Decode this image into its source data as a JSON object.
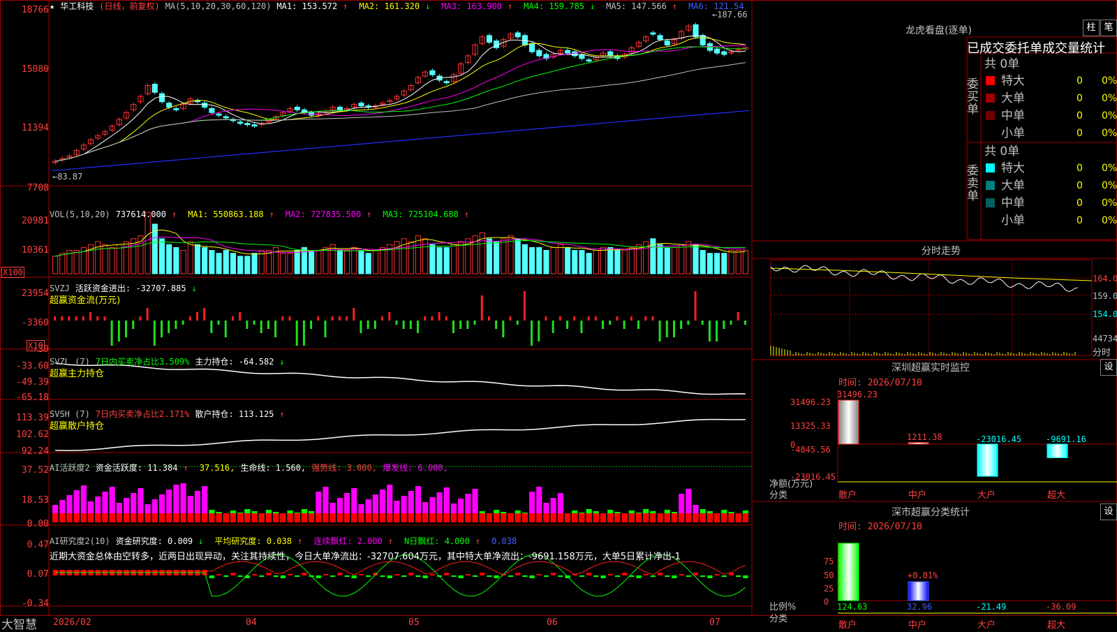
{
  "brand": "大智慧",
  "panels": {
    "price": {
      "star": "★",
      "stock_name": "华工科技",
      "mode": "(日线，前复权)",
      "ma_header": "MA(5,10,20,30,60,120)",
      "items": [
        {
          "label": "MA1: 153.572",
          "arrow": "↑",
          "color": "#ffffff"
        },
        {
          "label": "MA2: 161.320",
          "arrow": "↓",
          "color": "#ffff00"
        },
        {
          "label": "MA3: 163.900",
          "arrow": "↑",
          "color": "#ff00ff"
        },
        {
          "label": "MA4: 159.785",
          "arrow": "↓",
          "color": "#00ff00"
        },
        {
          "label": "MA5: 147.566",
          "arrow": "↑",
          "color": "#c0c0c0"
        },
        {
          "label": "MA6: 121.54",
          "arrow": "",
          "color": "#4060ff"
        }
      ],
      "y_ticks": [
        "18766",
        "15080",
        "11394",
        "7708"
      ],
      "high_mark": "187.66",
      "low_mark": "83.87"
    },
    "vol": {
      "header": "VOL(5,10,20)",
      "value": "737614.000",
      "items": [
        {
          "label": "MA1: 550863.188",
          "arrow": "↑",
          "color": "#ffff00"
        },
        {
          "label": "MA2: 727835.500",
          "arrow": "↑",
          "color": "#ff00ff"
        },
        {
          "label": "MA3: 725104.688",
          "arrow": "↑",
          "color": "#00ff00"
        }
      ],
      "y_ticks": [
        "20981",
        "10361"
      ],
      "unit": "X100"
    },
    "svzj": {
      "header": "SVZJ",
      "label": "活跃资金进出: -32707.885",
      "arrow": "↓",
      "sub": "超赢资金流(万元)",
      "y_ticks": [
        "23954",
        "-3360",
        "-30"
      ],
      "unit": "X10"
    },
    "svzl": {
      "header": "SVZL (7)",
      "green": "7日内买卖净占比3.509%",
      "label": "主力持仓: -64.582",
      "arrow": "↓",
      "sub": "超赢主力持仓",
      "y_ticks": [
        "-33.60",
        "-49.39",
        "-65.18"
      ]
    },
    "svsh": {
      "header": "SVSH (7)",
      "red": "7日内买卖净占比2.171%",
      "label": "散户持仓: 113.125",
      "arrow": "↑",
      "sub": "超赢散户持仓",
      "y_ticks": [
        "113.39",
        "102.62",
        "92.24"
      ]
    },
    "ai1": {
      "header": "AI活跃度2",
      "label": "资金活跃度: 11.384",
      "arrow": "↑",
      "v2": "37.516,",
      "v3": "生命线: 1.560,",
      "v4": "强势线: 3.000,",
      "v5": "爆发线: 6.000,",
      "y_ticks": [
        "37.52",
        "18.53",
        "0.00"
      ]
    },
    "ai2": {
      "header": "AI研究度2(10)",
      "label": "资金研究度: 0.009",
      "arrow": "↓",
      "v2": "平均研究度: 0.038",
      "v3": "连续飘红: 2.000",
      "v4": "N日飘红: 4.000",
      "v5": "0.038",
      "comment": "近期大资金总体由空转多，近两日出现异动，关注其持续性，今日大单净流出：-32707.604万元，其中特大单净流出：-9691.158万元，大单5日累计净出-1",
      "y_ticks": [
        "0.47",
        "0.07",
        "-0.34"
      ]
    }
  },
  "x_labels": [
    "2026/02",
    "04",
    "05",
    "06",
    "07"
  ],
  "right": {
    "lhb_title": "龙虎看盘(逐单)",
    "btn_bar": "柱",
    "btn_pen": "笔",
    "ob_header": "已成交委托单成交量统计",
    "buy_label": "委买单",
    "sell_label": "委卖单",
    "total_buy": "共 0单",
    "total_sell": "共 0单",
    "buy_rows": [
      {
        "name": "特大",
        "count": "0",
        "pct": "0%",
        "color": "#ff0000"
      },
      {
        "name": "大单",
        "count": "0",
        "pct": "0%",
        "color": "#a00000"
      },
      {
        "name": "中单",
        "count": "0",
        "pct": "0%",
        "color": "#700000"
      },
      {
        "name": "小单",
        "count": "0",
        "pct": "0%",
        "color": "#000000"
      }
    ],
    "sell_rows": [
      {
        "name": "特大",
        "count": "0",
        "pct": "0%",
        "color": "#00ffff"
      },
      {
        "name": "大单",
        "count": "0",
        "pct": "0%",
        "color": "#008080"
      },
      {
        "name": "中单",
        "count": "0",
        "pct": "0%",
        "color": "#006060"
      },
      {
        "name": "小单",
        "count": "0",
        "pct": "0%",
        "color": "#000000"
      }
    ],
    "intraday_title": "分时走势",
    "intraday_ticks": [
      "164.0",
      "159.0",
      "154.0"
    ],
    "intraday_vol": "44734",
    "intraday_unit": "分时",
    "sz_title": "深圳超赢实时监控",
    "sz_set": "设",
    "sz_time": "时间: 2026/07/10",
    "sz_yticks": [
      "31496.23",
      "13325.33",
      "0",
      "-4845.56",
      "-23016.45"
    ],
    "sz_label1": "净额(万元)",
    "sz_label2": "分类",
    "sz_cats": [
      "散户",
      "中户",
      "大户",
      "超大"
    ],
    "sz_vals": [
      "31496.23",
      "1211.38",
      "-23016.45",
      "-9691.16"
    ],
    "stat_title": "深市超赢分类统计",
    "stat_set": "设",
    "stat_time": "时间: 2026/07/10",
    "stat_yticks": [
      "75",
      "50",
      "25",
      "0"
    ],
    "stat_label1": "比例%",
    "stat_label2": "分类",
    "stat_cats": [
      "散户",
      "中户",
      "大户",
      "超大"
    ],
    "stat_vals": [
      "124.63",
      "32.96",
      "-21.49",
      "-36.09"
    ],
    "stat_note": "+0.01%"
  },
  "chart_data": [
    {
      "type": "candlestick",
      "title": "华工科技",
      "ylim": [
        7708,
        18766
      ],
      "ma_last": {
        "MA1": 153.572,
        "MA2": 161.32,
        "MA3": 163.9,
        "MA4": 159.785,
        "MA5": 147.566,
        "MA6": 121.54
      },
      "close": [
        84,
        86,
        88,
        92,
        96,
        100,
        103,
        106,
        110,
        115,
        120,
        126,
        132,
        140,
        135,
        128,
        124,
        122,
        126,
        130,
        128,
        124,
        120,
        118,
        116,
        114,
        112,
        111,
        110,
        112,
        114,
        117,
        120,
        123,
        122,
        120,
        118,
        119,
        121,
        124,
        122,
        123,
        126,
        125,
        124,
        125,
        127,
        129,
        132,
        136,
        140,
        146,
        150,
        148,
        144,
        142,
        148,
        156,
        162,
        170,
        176,
        172,
        168,
        174,
        178,
        176,
        170,
        165,
        162,
        160,
        163,
        166,
        164,
        162,
        160,
        158,
        161,
        164,
        162,
        160,
        163,
        168,
        172,
        176,
        178,
        174,
        170,
        174,
        180,
        184,
        176,
        170,
        166,
        164,
        163,
        165,
        167,
        168
      ],
      "open": [
        83,
        85,
        87,
        89,
        93,
        97,
        101,
        104,
        107,
        111,
        116,
        122,
        128,
        134,
        141,
        134,
        127,
        123,
        123,
        127,
        129,
        127,
        123,
        119,
        117,
        115,
        113,
        112,
        111,
        111,
        113,
        115,
        118,
        121,
        124,
        122,
        120,
        118,
        120,
        122,
        124,
        122,
        124,
        127,
        125,
        124,
        126,
        128,
        130,
        133,
        137,
        142,
        147,
        151,
        147,
        143,
        143,
        149,
        157,
        163,
        171,
        177,
        173,
        169,
        175,
        179,
        177,
        171,
        166,
        163,
        161,
        164,
        166,
        165,
        163,
        159,
        159,
        162,
        165,
        162,
        161,
        164,
        169,
        173,
        179,
        177,
        173,
        171,
        175,
        181,
        185,
        177,
        171,
        167,
        165,
        164,
        166,
        167
      ]
    },
    {
      "type": "bar",
      "title": "VOL(5,10,20)",
      "ylim": [
        0,
        20981
      ],
      "values": [
        6,
        7,
        8,
        8,
        9,
        10,
        11,
        10,
        9,
        10,
        11,
        12,
        13,
        21,
        17,
        12,
        10,
        9,
        8,
        11,
        10,
        9,
        8,
        7,
        8,
        7,
        6,
        6,
        7,
        8,
        8,
        9,
        7,
        7,
        8,
        9,
        8,
        8,
        9,
        10,
        8,
        8,
        9,
        8,
        7,
        8,
        9,
        10,
        11,
        12,
        11,
        13,
        12,
        10,
        9,
        9,
        10,
        11,
        12,
        13,
        14,
        12,
        11,
        12,
        13,
        12,
        10,
        9,
        9,
        8,
        9,
        10,
        9,
        8,
        8,
        7,
        8,
        9,
        9,
        8,
        8,
        9,
        10,
        11,
        12,
        10,
        9,
        9,
        10,
        11,
        10,
        8,
        7,
        7,
        7,
        8,
        8,
        8
      ]
    },
    {
      "type": "bar",
      "title": "超赢资金流(万元)",
      "ylim": [
        -30,
        23954
      ],
      "values": [
        1,
        1,
        1,
        1,
        1,
        2,
        1,
        1,
        -6,
        -5,
        -4,
        -2,
        1,
        3,
        -6,
        -4,
        -3,
        -2,
        -1,
        1,
        2,
        3,
        -3,
        -1,
        -4,
        1,
        2,
        -2,
        -1,
        -3,
        -2,
        -4,
        1,
        1,
        -6,
        -6,
        -2,
        1,
        -4,
        1,
        1,
        1,
        3,
        -3,
        -2,
        -2,
        1,
        2,
        -1,
        -2,
        -2,
        -3,
        1,
        1,
        2,
        1,
        -3,
        -2,
        -2,
        -1,
        6,
        1,
        -2,
        -4,
        1,
        -1,
        7,
        -6,
        -5,
        1,
        -3,
        1,
        -2,
        1,
        -3,
        1,
        1,
        -2,
        -1,
        1,
        -2,
        1,
        -2,
        1,
        1,
        -5,
        -4,
        -4,
        -2,
        -1,
        7,
        -1,
        -5,
        -5,
        -2,
        -1,
        2,
        -1
      ]
    }
  ]
}
